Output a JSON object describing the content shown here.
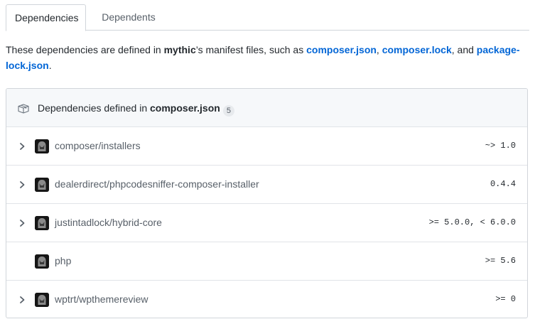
{
  "tabs": {
    "active_label": "Dependencies",
    "inactive_label": "Dependents"
  },
  "intro": {
    "prefix": "These dependencies are defined in ",
    "repo": "mythic",
    "middle": "’s manifest files, such as ",
    "file1": "composer.json",
    "sep1": ", ",
    "file2": "composer.lock",
    "sep2": ", and ",
    "file3": "package-lock.json",
    "suffix": "."
  },
  "box": {
    "title_prefix": "Dependencies defined in ",
    "title_file": "composer.json",
    "count": "5"
  },
  "dependencies": [
    {
      "name": "composer/installers",
      "version": "~> 1.0",
      "expandable": true
    },
    {
      "name": "dealerdirect/phpcodesniffer-composer-installer",
      "version": "0.4.4",
      "expandable": true
    },
    {
      "name": "justintadlock/hybrid-core",
      "version": ">= 5.0.0, < 6.0.0",
      "expandable": true
    },
    {
      "name": "php",
      "version": ">= 5.6",
      "expandable": false
    },
    {
      "name": "wptrt/wpthemereview",
      "version": ">= 0",
      "expandable": true
    }
  ],
  "icons": {
    "header": "package-icon",
    "row_toggle": "chevron-right-icon",
    "row_avatar": "avatar-icon"
  },
  "colors": {
    "link": "#0366d6",
    "text": "#24292e",
    "muted": "#586069",
    "border": "#d1d5da",
    "header_bg": "#f6f8fa"
  }
}
